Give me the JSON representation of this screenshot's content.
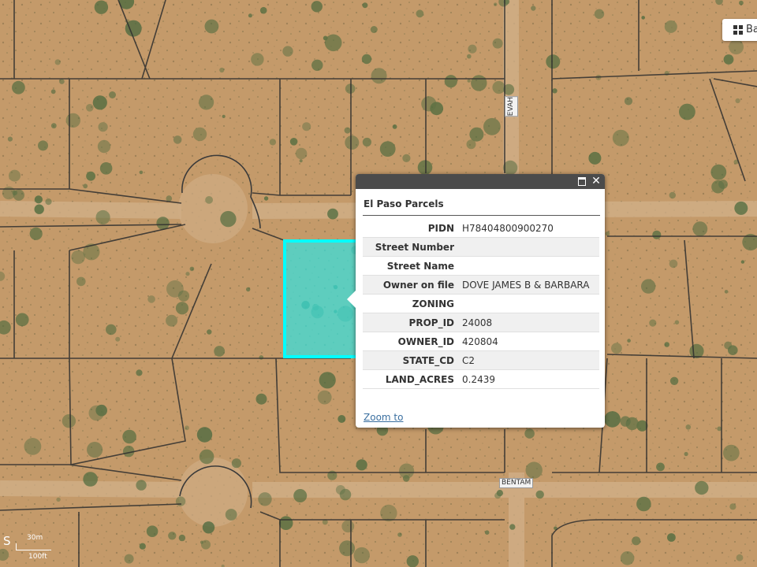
{
  "basemap_button": {
    "icon": "grid-icon",
    "label": "Ba"
  },
  "road_labels": {
    "vertical": "EVAH",
    "horizontal": "BENTAM"
  },
  "scale_bar": {
    "top": "30m",
    "bottom": "100ft",
    "left_char": "S"
  },
  "popup": {
    "title": "El Paso Parcels",
    "rows": [
      {
        "key": "PIDN",
        "value": "H78404800900270"
      },
      {
        "key": "Street Number",
        "value": ""
      },
      {
        "key": "Street Name",
        "value": ""
      },
      {
        "key": "Owner on file",
        "value": "DOVE JAMES B & BARBARA"
      },
      {
        "key": "ZONING",
        "value": ""
      },
      {
        "key": "PROP_ID",
        "value": "24008"
      },
      {
        "key": "OWNER_ID",
        "value": "420804"
      },
      {
        "key": "STATE_CD",
        "value": "C2"
      },
      {
        "key": "LAND_ACRES",
        "value": "0.2439"
      }
    ],
    "zoom_link": "Zoom to"
  },
  "colors": {
    "terrain": "#c49a6a",
    "parcel_highlight": "#00ffff",
    "popup_titlebar": "#4b4b4b",
    "link": "#3a6fa0"
  }
}
